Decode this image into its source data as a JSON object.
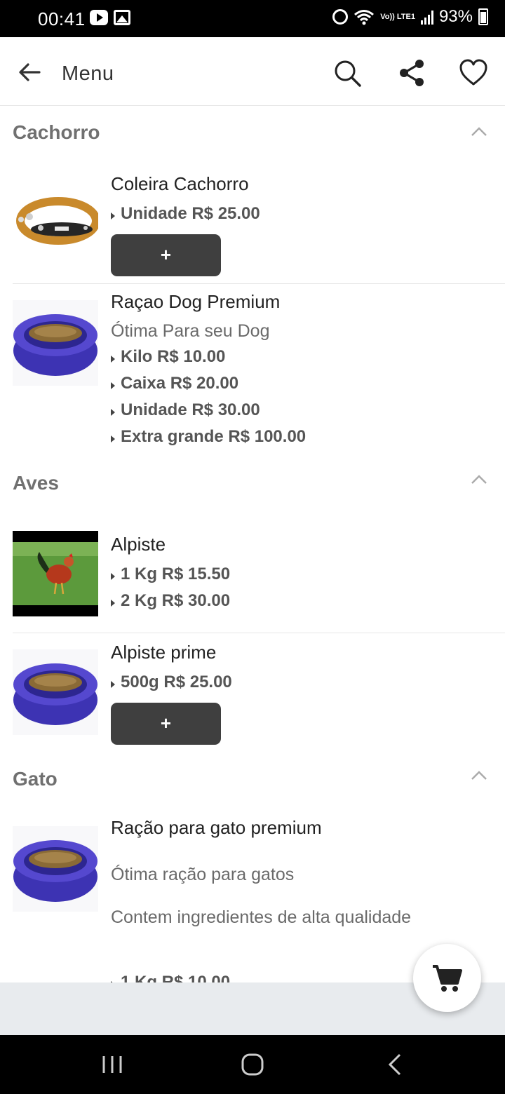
{
  "status_bar": {
    "time": "00:41",
    "battery": "93%",
    "network_label": "Vo)) LTE1"
  },
  "header": {
    "title": "Menu"
  },
  "icons": {
    "back": "arrow-left-icon",
    "search": "search-icon",
    "share": "share-icon",
    "favorite": "heart-icon",
    "cart": "cart-icon"
  },
  "sections": [
    {
      "title": "Cachorro",
      "items": [
        {
          "name": "Coleira Cachorro",
          "prices": [
            "Unidade R$ 25.00"
          ],
          "add_label": "+"
        },
        {
          "name": "Raçao Dog Premium",
          "description": "Ótima Para seu Dog",
          "prices": [
            "Kilo R$ 10.00",
            "Caixa R$ 20.00",
            "Unidade R$ 30.00",
            "Extra grande R$ 100.00"
          ]
        }
      ]
    },
    {
      "title": "Aves",
      "items": [
        {
          "name": "Alpiste",
          "prices": [
            "1 Kg R$ 15.50",
            "2 Kg R$ 30.00"
          ]
        },
        {
          "name": "Alpiste prime",
          "prices": [
            "500g R$ 25.00"
          ],
          "add_label": "+"
        }
      ]
    },
    {
      "title": "Gato",
      "items": [
        {
          "name": "Ração para gato premium",
          "description": "Ótima ração para gatos",
          "description2": "Contem ingredientes de alta qualidade",
          "prices": [
            "1 Kg R$ 10.00"
          ]
        }
      ]
    }
  ]
}
